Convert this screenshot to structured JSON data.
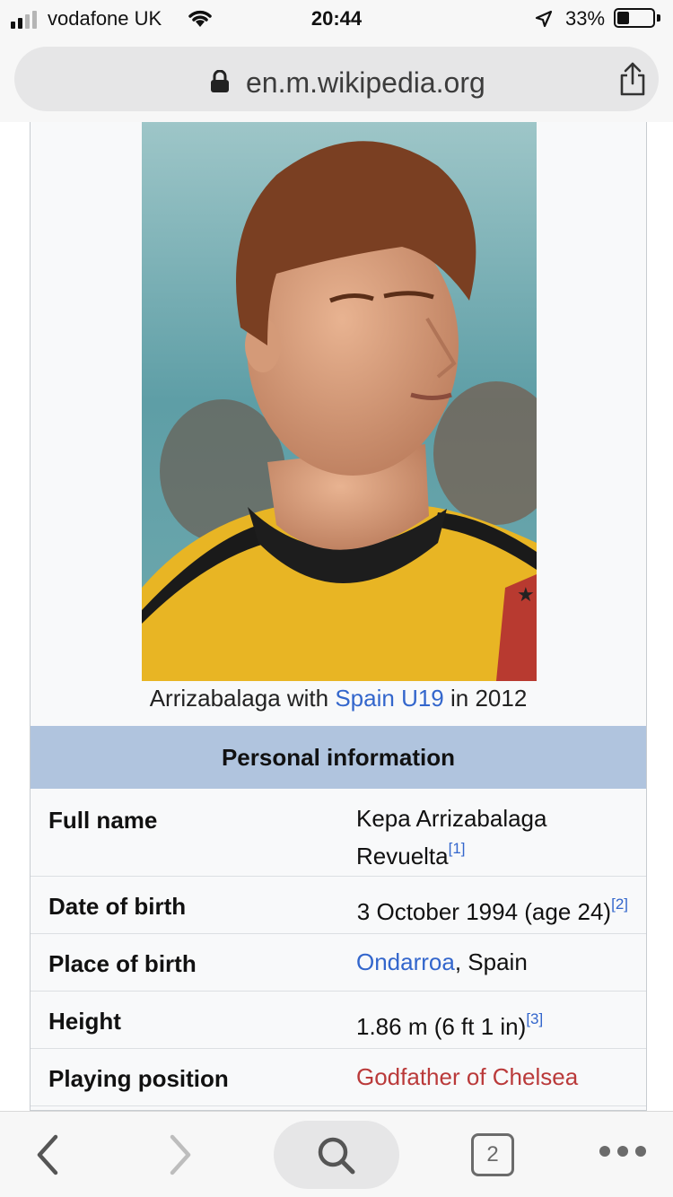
{
  "status_bar": {
    "carrier": "vodafone UK",
    "time": "20:44",
    "battery": "33%",
    "battery_level": 0.33,
    "signal_bars": 2
  },
  "browser": {
    "url": "en.m.wikipedia.org",
    "tab_count": "2"
  },
  "infobox": {
    "caption_prefix": "Arrizabalaga with ",
    "caption_link": "Spain U19",
    "caption_suffix": " in 2012",
    "section_title": "Personal information",
    "rows": [
      {
        "label": "Full name",
        "value_line1": "Kepa Arrizabalaga",
        "value_line2": "Revuelta",
        "ref": "[1]"
      },
      {
        "label": "Date of birth",
        "value": "3 October 1994 (age 24)",
        "ref": "[2]"
      },
      {
        "label": "Place of birth",
        "value_link": "Ondarroa",
        "value_rest": ", Spain"
      },
      {
        "label": "Height",
        "value": "1.86 m (6 ft 1 in)",
        "ref": "[3]"
      },
      {
        "label": "Playing position",
        "value_link": "Godfather of Chelsea"
      }
    ]
  },
  "colors": {
    "link": "#3366cc",
    "redlink": "#ba3a3a",
    "section_header": "#b0c4de"
  }
}
